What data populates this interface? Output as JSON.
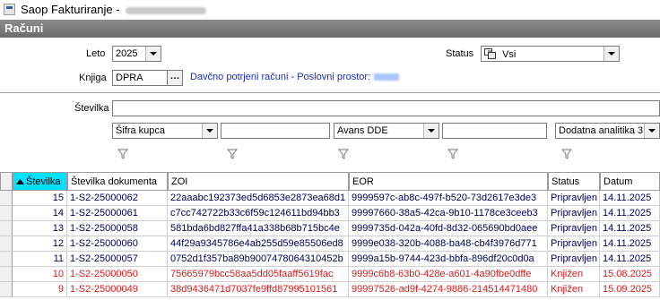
{
  "window": {
    "title": "Saop Fakturiranje -"
  },
  "pane": {
    "title": "Računi"
  },
  "form": {
    "leto_label": "Leto",
    "leto_value": "2025",
    "status_label": "Status",
    "status_value": "Vsi",
    "knjiga_label": "Knjiga",
    "knjiga_value": "DPRA",
    "knjiga_desc": "Davčno potrjeni računi - Poslovni prostor:",
    "stevilka_label": "Številka",
    "filter1": "Šifra kupca",
    "filter2": "Avans DDE",
    "filter3": "Dodatna analitika 3"
  },
  "colors": {
    "blue_row": "#00005a",
    "red_row": "#e01818",
    "header_selected": "#00e0ff"
  },
  "table": {
    "columns": [
      "Številka",
      "Številka dokumenta",
      "ZOI",
      "EOR",
      "Status",
      "Datum"
    ],
    "rows": [
      {
        "num": "15",
        "doc": "1-S2-25000062",
        "zoi": "22aaabc192373ed5d6853e2873ea68d1",
        "eor": "9999597c-ab8c-497f-b520-73d2617e3de3",
        "status": "Pripravljen",
        "date": "14.11.2025",
        "tone": "blue"
      },
      {
        "num": "14",
        "doc": "1-S2-25000061",
        "zoi": "c7cc742722b33c6f59c124611bd94bb3",
        "eor": "99997660-38a5-42ca-9b10-1178ce3ceeb3",
        "status": "Pripravljen",
        "date": "14.11.2025",
        "tone": "blue"
      },
      {
        "num": "13",
        "doc": "1-S2-25000058",
        "zoi": "581bda6bd827ffa41a338b68b715bc4e",
        "eor": "9999735d-042a-40fd-8d32-065690bd0aee",
        "status": "Pripravljen",
        "date": "14.11.2025",
        "tone": "blue"
      },
      {
        "num": "12",
        "doc": "1-S2-25000060",
        "zoi": "44f29a9345786e4ab255d59e85506ed8",
        "eor": "9999e038-320b-4088-ba48-cb4f3976d771",
        "status": "Pripravljen",
        "date": "14.11.2025",
        "tone": "blue"
      },
      {
        "num": "11",
        "doc": "1-S2-25000057",
        "zoi": "0752d1f357ba89b9007478064310452b",
        "eor": "9999a15b-9744-423d-bbfa-896df20c0d0a",
        "status": "Pripravljen",
        "date": "14.11.2025",
        "tone": "blue"
      },
      {
        "num": "10",
        "doc": "1-S2-25000050",
        "zoi": "75665979bcc58aa5dd05faaff5619fac",
        "eor": "9999c6b8-63b0-428e-a601-4a90fbe0dffe",
        "status": "Knjižen",
        "date": "15.08.2025",
        "tone": "red"
      },
      {
        "num": "9",
        "doc": "1-S2-25000049",
        "zoi": "38d9436471d7037fe9ffd87995101561",
        "eor": "99997526-ad9f-4274-9886-214514471480",
        "status": "Knjižen",
        "date": "15.09.2025",
        "tone": "red"
      }
    ]
  }
}
